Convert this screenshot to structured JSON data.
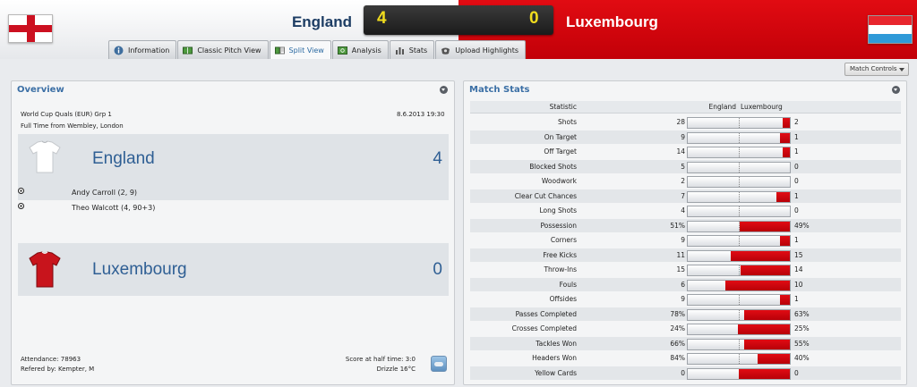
{
  "header": {
    "home_team": "England",
    "away_team": "Luxembourg",
    "home_score": "4",
    "away_score": "0",
    "home_color": "#1d3d64",
    "away_color": "#d50a12",
    "score_color": "#f0dc1e",
    "home_flag": "england-flag-icon",
    "away_flag": "luxembourg-flag-icon"
  },
  "tabs": [
    {
      "label": "Information",
      "icon": "info-icon"
    },
    {
      "label": "Classic Pitch View",
      "icon": "pitch-icon"
    },
    {
      "label": "Split View",
      "icon": "split-view-icon",
      "active": true
    },
    {
      "label": "Analysis",
      "icon": "analysis-icon"
    },
    {
      "label": "Stats",
      "icon": "stats-icon"
    },
    {
      "label": "Upload Highlights",
      "icon": "upload-icon"
    }
  ],
  "match_controls": "Match Controls",
  "overview": {
    "title": "Overview",
    "competition": "World Cup Quals (EUR) Grp 1",
    "datetime": "8.6.2013 19:30",
    "venue": "Full Time from Wembley, London",
    "home": {
      "name": "England",
      "score": "4",
      "kit": "white-shirt-icon"
    },
    "away": {
      "name": "Luxembourg",
      "score": "0",
      "kit": "red-shirt-icon"
    },
    "goals": [
      "Andy Carroll (2, 9)",
      "Theo Walcott (4, 90+3)"
    ],
    "attendance": "Attendance: 78963",
    "referee": "Refered by: Kempter, M",
    "half_time": "Score at half time: 3:0",
    "weather": "Drizzle 16°C"
  },
  "stats": {
    "title": "Match Stats",
    "col_statistic": "Statistic",
    "col_home": "England",
    "col_away": "Luxembourg",
    "rows": [
      {
        "label": "Shots",
        "home": "28",
        "away": "2",
        "away_share": 0.07
      },
      {
        "label": "On Target",
        "home": "9",
        "away": "1",
        "away_share": 0.1
      },
      {
        "label": "Off Target",
        "home": "14",
        "away": "1",
        "away_share": 0.07
      },
      {
        "label": "Blocked Shots",
        "home": "5",
        "away": "0",
        "away_share": 0
      },
      {
        "label": "Woodwork",
        "home": "2",
        "away": "0",
        "away_share": 0
      },
      {
        "label": "Clear Cut Chances",
        "home": "7",
        "away": "1",
        "away_share": 0.13
      },
      {
        "label": "Long Shots",
        "home": "4",
        "away": "0",
        "away_share": 0
      },
      {
        "label": "Possession",
        "home": "51%",
        "away": "49%",
        "away_share": 0.49
      },
      {
        "label": "Corners",
        "home": "9",
        "away": "1",
        "away_share": 0.1
      },
      {
        "label": "Free Kicks",
        "home": "11",
        "away": "15",
        "away_share": 0.58
      },
      {
        "label": "Throw-Ins",
        "home": "15",
        "away": "14",
        "away_share": 0.48
      },
      {
        "label": "Fouls",
        "home": "6",
        "away": "10",
        "away_share": 0.63
      },
      {
        "label": "Offsides",
        "home": "9",
        "away": "1",
        "away_share": 0.1
      },
      {
        "label": "Passes Completed",
        "home": "78%",
        "away": "63%",
        "away_share": 0.45
      },
      {
        "label": "Crosses Completed",
        "home": "24%",
        "away": "25%",
        "away_share": 0.51
      },
      {
        "label": "Tackles Won",
        "home": "66%",
        "away": "55%",
        "away_share": 0.45
      },
      {
        "label": "Headers Won",
        "home": "84%",
        "away": "40%",
        "away_share": 0.32
      },
      {
        "label": "Yellow Cards",
        "home": "0",
        "away": "0",
        "away_share": 0.5
      }
    ]
  }
}
